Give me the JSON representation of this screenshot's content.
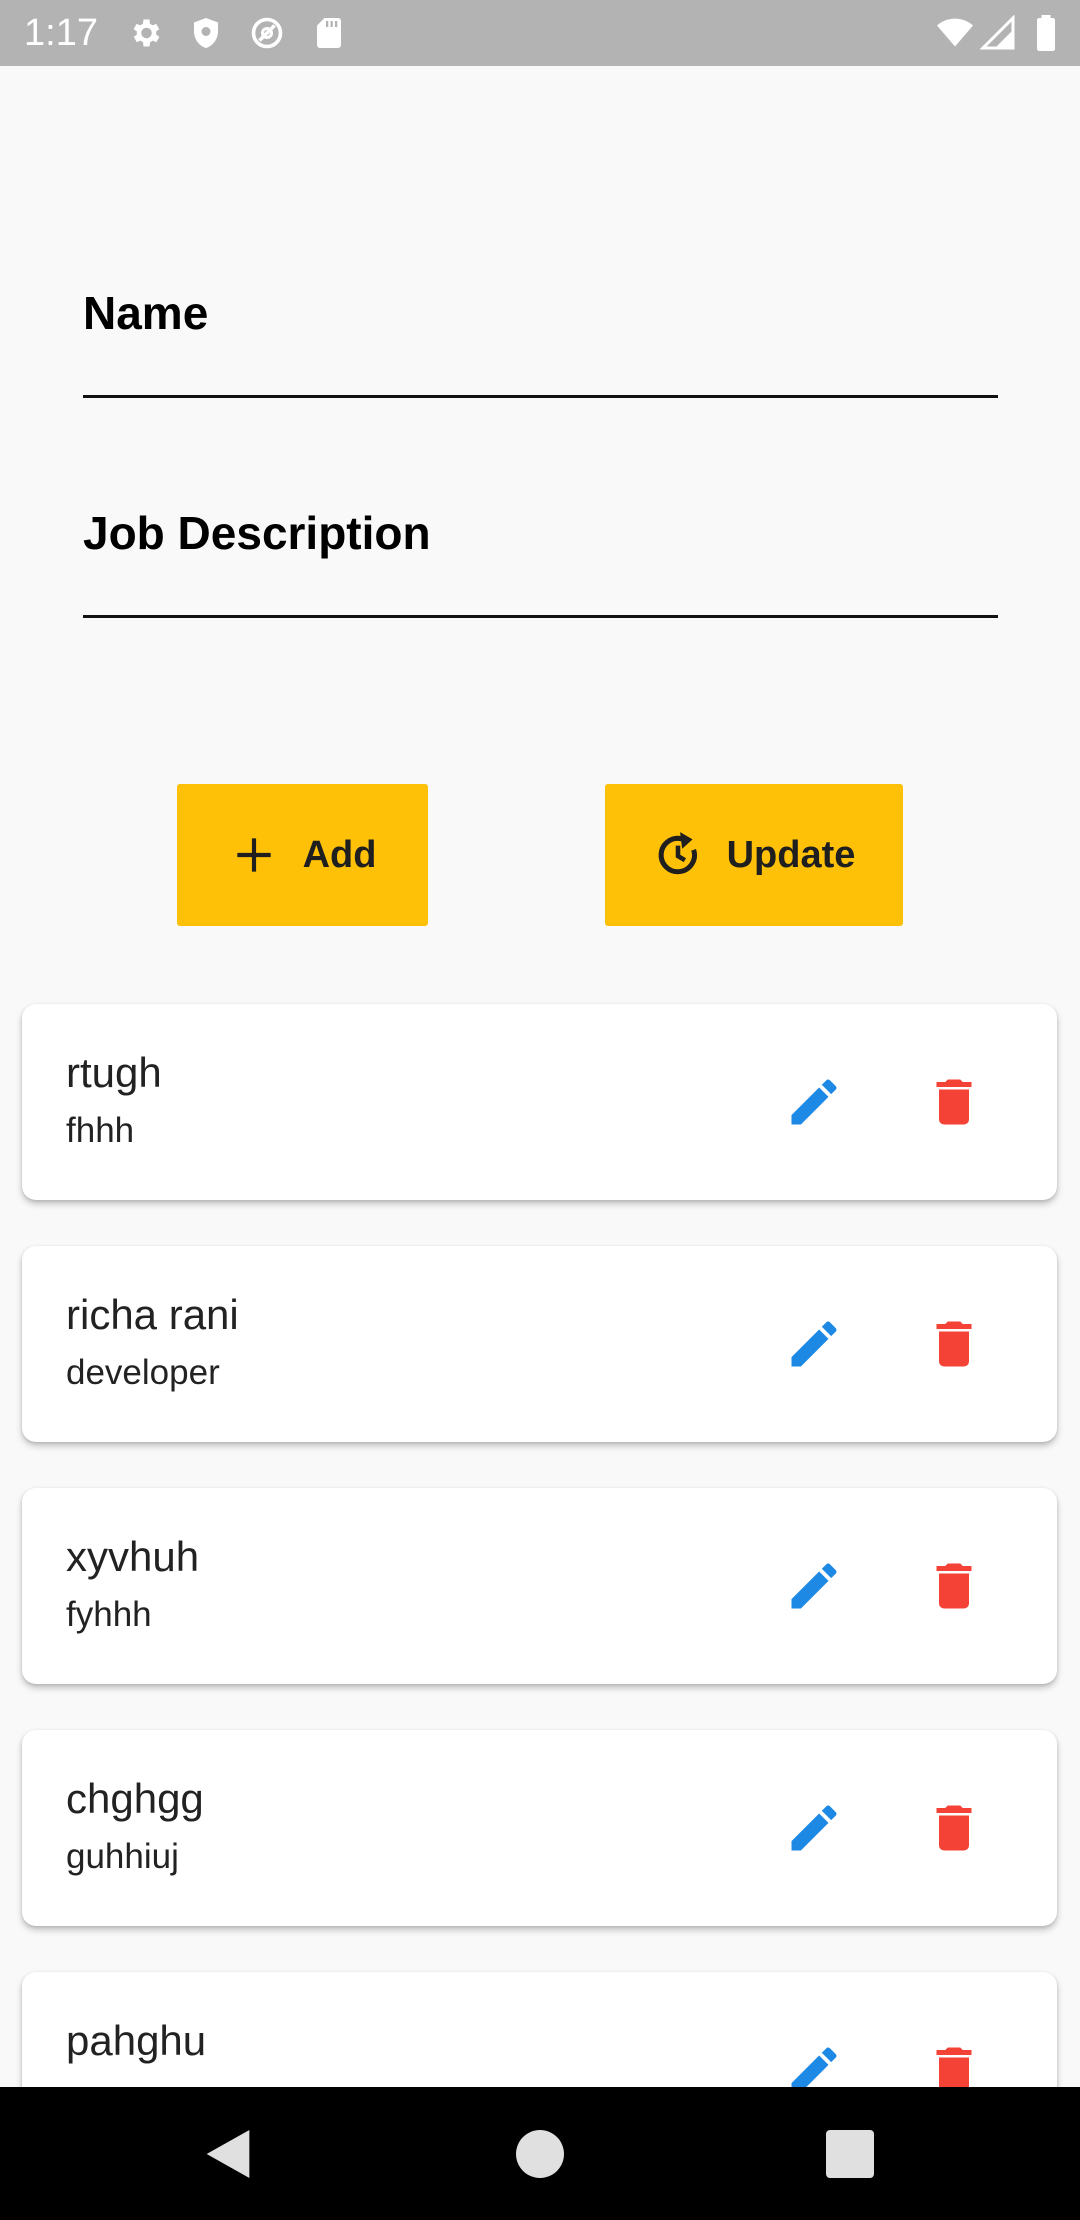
{
  "status_bar": {
    "time": "1:17",
    "icons": [
      "gear-icon",
      "shield-icon",
      "at-sign-icon",
      "sd-card-icon",
      "wifi-icon",
      "signal-icon",
      "battery-icon"
    ]
  },
  "form": {
    "name_label": "Name",
    "name_value": "",
    "job_label": "Job Description",
    "job_value": ""
  },
  "buttons": {
    "add_label": "Add",
    "add_icon": "plus-icon",
    "update_label": "Update",
    "update_icon": "refresh-clock-icon",
    "color": "#ffc107"
  },
  "employees": [
    {
      "name": "rtugh",
      "job": "fhhh"
    },
    {
      "name": "richa rani",
      "job": "developer"
    },
    {
      "name": "xyvhuh",
      "job": "fyhhh"
    },
    {
      "name": "chghgg",
      "job": "guhhiuj"
    },
    {
      "name": "pahghu",
      "job": ""
    }
  ],
  "actions": {
    "edit_icon": "pencil-icon",
    "edit_color": "#1e88e5",
    "delete_icon": "trash-icon",
    "delete_color": "#f44336"
  },
  "nav": {
    "icons": [
      "back-icon",
      "home-icon",
      "recents-icon"
    ]
  }
}
